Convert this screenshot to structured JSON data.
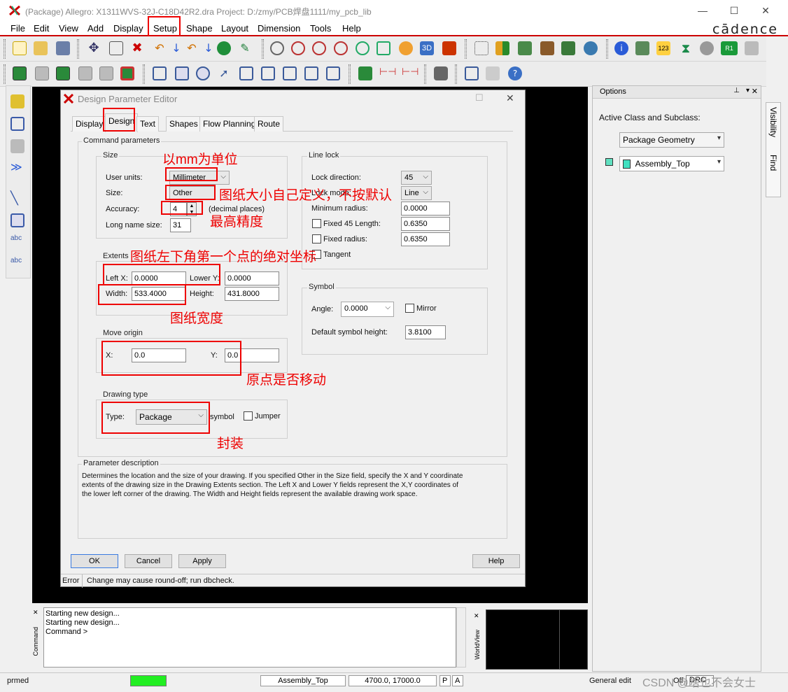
{
  "window": {
    "title": "(Package) Allegro: X1311WVS-32J-C18D42R2.dra  Project: D:/zmy/PCB焊盘1111/my_pcb_lib",
    "brand": "cādence"
  },
  "menu": [
    "File",
    "Edit",
    "View",
    "Add",
    "Display",
    "Setup",
    "Shape",
    "Layout",
    "Dimension",
    "Tools",
    "Help"
  ],
  "options_panel": {
    "title": "Options",
    "active_label": "Active Class and Subclass:",
    "class_value": "Package Geometry",
    "subclass_value": "Assembly_Top",
    "side_tabs": [
      "Visibility",
      "Find"
    ]
  },
  "dialog": {
    "title": "Design Parameter Editor",
    "tabs": [
      "Display",
      "Design",
      "Text",
      "Shapes",
      "Flow Planning",
      "Route"
    ],
    "command_params": "Command parameters",
    "size": {
      "group": "Size",
      "user_units_label": "User units:",
      "user_units": "Millimeter",
      "size_label": "Size:",
      "size_value": "Other",
      "accuracy_label": "Accuracy:",
      "accuracy": "4",
      "decimal_note": "(decimal places)",
      "long_name_label": "Long name size:",
      "long_name": "31"
    },
    "extents": {
      "group": "Extents",
      "left_x_label": "Left X:",
      "left_x": "0.0000",
      "lower_y_label": "Lower Y:",
      "lower_y": "0.0000",
      "width_label": "Width:",
      "width": "533.4000",
      "height_label": "Height:",
      "height": "431.8000"
    },
    "move_origin": {
      "group": "Move origin",
      "x_label": "X:",
      "x": "0.0",
      "y_label": "Y:",
      "y": "0.0"
    },
    "drawing_type": {
      "group": "Drawing type",
      "type_label": "Type:",
      "type": "Package",
      "symbol_label": "symbol",
      "jumper_label": "Jumper"
    },
    "line_lock": {
      "group": "Line lock",
      "lock_direction_label": "Lock direction:",
      "lock_direction": "45",
      "lock_mode_label": "Lock mode:",
      "lock_mode": "Line",
      "min_radius_label": "Minimum radius:",
      "min_radius": "0.0000",
      "fixed45_label": "Fixed 45 Length:",
      "fixed45": "0.6350",
      "fixed_radius_label": "Fixed radius:",
      "fixed_radius": "0.6350",
      "tangent_label": "Tangent"
    },
    "symbol": {
      "group": "Symbol",
      "angle_label": "Angle:",
      "angle": "0.0000",
      "mirror_label": "Mirror",
      "height_label": "Default symbol height:",
      "height": "3.8100"
    },
    "param_desc": {
      "group": "Parameter description",
      "line1": "Determines the location and the size of your drawing.  If you specified Other in the Size field, specify the X and Y coordinate",
      "line2": "extents of the drawing size in the Drawing Extents section. The Left X and Lower Y fields represent the X,Y coordinates of",
      "line3": "the lower left corner of the drawing.  The Width and Height fields represent the available drawing work space."
    },
    "buttons": {
      "ok": "OK",
      "cancel": "Cancel",
      "apply": "Apply",
      "help": "Help"
    },
    "status_label": "Error",
    "status_msg": "Change may cause round-off; run dbcheck."
  },
  "annotations": {
    "units": "以mm为单位",
    "size": "图纸大小自己定义，不按默认",
    "accuracy": "最高精度",
    "extents": "图纸左下角第一个点的绝对坐标",
    "width": "图纸宽度",
    "origin": "原点是否移动",
    "package": "封装"
  },
  "command_window": {
    "line1": "Starting new design...",
    "line2": "Starting new design...",
    "line3": "Command >",
    "label": "Command",
    "worldview_label": "WorldView"
  },
  "statusbar": {
    "mode": "prmed",
    "subclass": "Assembly_Top",
    "coords": "4700.0, 17000.0",
    "p": "P",
    "a": "A",
    "general": "General edit",
    "off": "Off",
    "drc": "DRC"
  },
  "watermark": "CSDN @啥也不会女士"
}
